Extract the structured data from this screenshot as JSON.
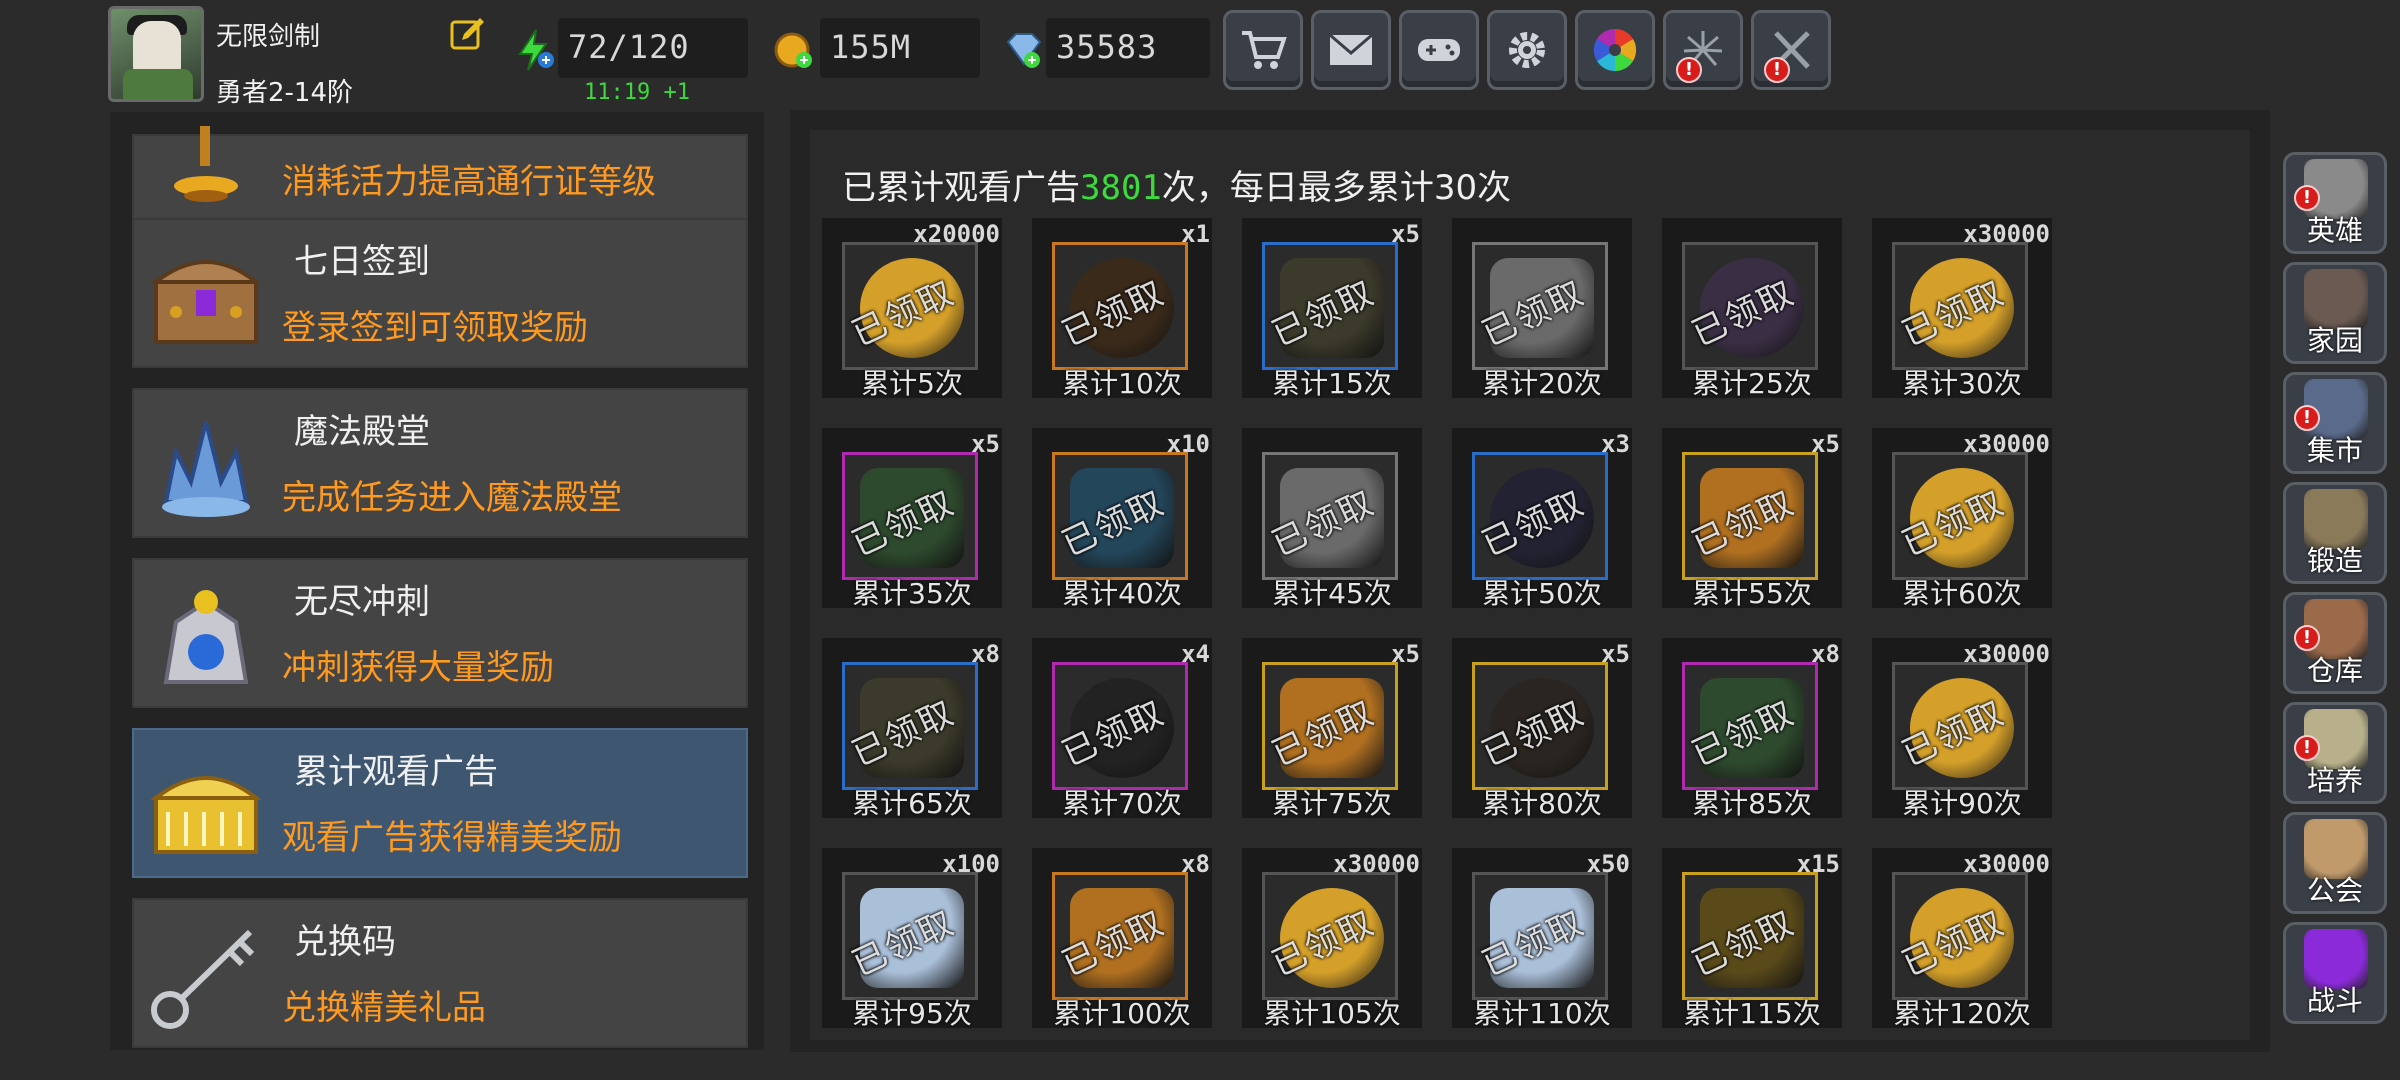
{
  "player": {
    "name": "无限剑制",
    "rank": "勇者2-14阶"
  },
  "resources": {
    "energy": "72/120",
    "energy_timer": "11:19 +1",
    "gold": "155M",
    "gems": "35583"
  },
  "top_buttons": [
    {
      "name": "shop",
      "icon": "cart-icon",
      "alert": false
    },
    {
      "name": "mail",
      "icon": "envelope-icon",
      "alert": false
    },
    {
      "name": "gamepad",
      "icon": "gamepad-icon",
      "alert": false
    },
    {
      "name": "settings",
      "icon": "gear-icon",
      "alert": false
    },
    {
      "name": "lucky-wheel",
      "icon": "color-wheel-icon",
      "alert": false
    },
    {
      "name": "events",
      "icon": "firework-icon",
      "alert": true
    },
    {
      "name": "battle-pass",
      "icon": "swords-icon",
      "alert": true
    }
  ],
  "menu": [
    {
      "id": "pass",
      "title": "",
      "desc": "消耗活力提高通行证等级",
      "icon": "lamp-icon",
      "active": false
    },
    {
      "id": "seven-day",
      "title": "七日签到",
      "desc": "登录签到可领取奖励",
      "icon": "treasure-chest-icon",
      "active": false
    },
    {
      "id": "magic-hall",
      "title": "魔法殿堂",
      "desc": "完成任务进入魔法殿堂",
      "icon": "crystal-crown-icon",
      "active": false
    },
    {
      "id": "endless",
      "title": "无尽冲刺",
      "desc": "冲刺获得大量奖励",
      "icon": "knight-statue-icon",
      "active": false
    },
    {
      "id": "ads",
      "title": "累计观看广告",
      "desc": "观看广告获得精美奖励",
      "icon": "gold-chest-icon",
      "active": true
    },
    {
      "id": "redeem",
      "title": "兑换码",
      "desc": "兑换精美礼品",
      "icon": "key-icon",
      "active": false
    }
  ],
  "main": {
    "headline_prefix": "已累计观看广告",
    "headline_count": "3801",
    "headline_suffix": "次，每日最多累计30次",
    "claimed_text": "已领取",
    "rewards": [
      {
        "count": "x20000",
        "label": "累计5次",
        "item": "gold-coin",
        "color": "#d4a02a",
        "frame": "#555555"
      },
      {
        "count": "x1",
        "label": "累计10次",
        "item": "dark-armor",
        "color": "#3a2a1a",
        "frame": "#c8781e"
      },
      {
        "count": "x5",
        "label": "累计15次",
        "item": "dark-gem",
        "color": "#3c3a2a",
        "frame": "#2a6cc8"
      },
      {
        "count": "",
        "label": "累计20次",
        "item": "gear-part",
        "color": "#6a6a6a",
        "frame": "#777777"
      },
      {
        "count": "",
        "label": "累计25次",
        "item": "hero-figure",
        "color": "#3a2e44",
        "frame": "#555555"
      },
      {
        "count": "x30000",
        "label": "累计30次",
        "item": "gold-coin",
        "color": "#d4a02a",
        "frame": "#555555"
      },
      {
        "count": "x5",
        "label": "累计35次",
        "item": "green-gem",
        "color": "#2e4a2e",
        "frame": "#b02ab0"
      },
      {
        "count": "x10",
        "label": "累计40次",
        "item": "blue-book",
        "color": "#24465a",
        "frame": "#c8781e"
      },
      {
        "count": "",
        "label": "累计45次",
        "item": "gear-part",
        "color": "#6a6a6a",
        "frame": "#777777"
      },
      {
        "count": "x3",
        "label": "累计50次",
        "item": "dark-armor",
        "color": "#222232",
        "frame": "#2a6cc8"
      },
      {
        "count": "x5",
        "label": "累计55次",
        "item": "amber-gem",
        "color": "#b07020",
        "frame": "#c8a01e"
      },
      {
        "count": "x30000",
        "label": "累计60次",
        "item": "gold-coin",
        "color": "#d4a02a",
        "frame": "#555555"
      },
      {
        "count": "x8",
        "label": "累计65次",
        "item": "dark-gem",
        "color": "#3c3a2a",
        "frame": "#2a6cc8"
      },
      {
        "count": "x4",
        "label": "累计70次",
        "item": "dark-armor",
        "color": "#222222",
        "frame": "#b02ab0"
      },
      {
        "count": "x5",
        "label": "累计75次",
        "item": "amber-gem",
        "color": "#b07020",
        "frame": "#c8a01e"
      },
      {
        "count": "x5",
        "label": "累计80次",
        "item": "dark-armor",
        "color": "#2a2520",
        "frame": "#c8a01e"
      },
      {
        "count": "x8",
        "label": "累计85次",
        "item": "green-gem",
        "color": "#2e4a2e",
        "frame": "#b02ab0"
      },
      {
        "count": "x30000",
        "label": "累计90次",
        "item": "gold-coin",
        "color": "#d4a02a",
        "frame": "#555555"
      },
      {
        "count": "x100",
        "label": "累计95次",
        "item": "crystal-shard",
        "color": "#aabfd8",
        "frame": "#555555"
      },
      {
        "count": "x8",
        "label": "累计100次",
        "item": "amber-gem",
        "color": "#b07020",
        "frame": "#c8781e"
      },
      {
        "count": "x30000",
        "label": "累计105次",
        "item": "gold-coin",
        "color": "#d4a02a",
        "frame": "#555555"
      },
      {
        "count": "x50",
        "label": "累计110次",
        "item": "crystal-shard",
        "color": "#aabfd8",
        "frame": "#555555"
      },
      {
        "count": "x15",
        "label": "累计115次",
        "item": "lightning-rune",
        "color": "#5a4a1a",
        "frame": "#c8a01e"
      },
      {
        "count": "x30000",
        "label": "累计120次",
        "item": "gold-coin",
        "color": "#d4a02a",
        "frame": "#555555"
      }
    ]
  },
  "right_nav": [
    {
      "label": "英雄",
      "icon": "helmet-icon",
      "alert": true,
      "color": "#8a8a8a"
    },
    {
      "label": "家园",
      "icon": "castle-icon",
      "alert": false,
      "color": "#6a5a52"
    },
    {
      "label": "集市",
      "icon": "market-stall-icon",
      "alert": true,
      "color": "#5a6a8a"
    },
    {
      "label": "锻造",
      "icon": "anvil-icon",
      "alert": false,
      "color": "#8a7a5a"
    },
    {
      "label": "仓库",
      "icon": "warehouse-icon",
      "alert": true,
      "color": "#9a6a4a"
    },
    {
      "label": "培养",
      "icon": "chalice-icon",
      "alert": true,
      "color": "#b8b08a"
    },
    {
      "label": "公会",
      "icon": "guild-icon",
      "alert": false,
      "color": "#c09a6a"
    },
    {
      "label": "战斗",
      "icon": "portal-icon",
      "alert": false,
      "color": "#8a2ad8"
    }
  ]
}
